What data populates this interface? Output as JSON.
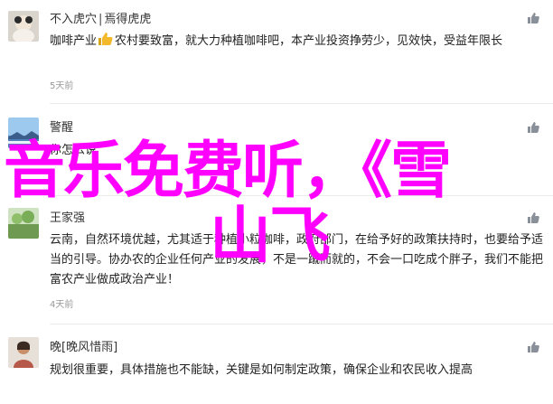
{
  "comments": [
    {
      "username": "不入虎穴",
      "separator": "|",
      "reply_to": "焉得虎虎",
      "body_before_icon": "咖啡产业",
      "inline_icon": "thumbs-up-icon",
      "body_after_icon": "农村要致富，就大力种植咖啡吧，本产业投资挣劳少，见效快，受益年限长",
      "time": "5天前",
      "like_icon": "thumbs-up-icon"
    },
    {
      "username": "警醒",
      "body_fragment": "你怎么说",
      "like_icon": "thumbs-up-icon"
    },
    {
      "username": "王家强",
      "body": "云南，自然环境优越，尤其适于种植小粒咖啡，政府部门，在给予好的政策扶持时，也要给予适当的引导。协办农的企业任何产业的发展，不是一蹴而就的，不会一口吃成个胖子，我们不能把富农产业做成政治产业！",
      "time": "4天前",
      "like_icon": "thumbs-up-icon"
    },
    {
      "username": "晚",
      "username_suffix": "[晚风惜雨]",
      "body": "规划很重要，具体措施也不能缺，关键是如何制定政策，确保企业和农民收入提高",
      "like_icon": "thumbs-up-icon"
    }
  ],
  "watermark": {
    "line1": "音乐免费听，《雪",
    "line2": "山飞",
    "color": "#ff00ff"
  },
  "colors": {
    "text": "#222222",
    "meta": "#999999",
    "icon": "#8a9099",
    "divider": "#ececec"
  }
}
